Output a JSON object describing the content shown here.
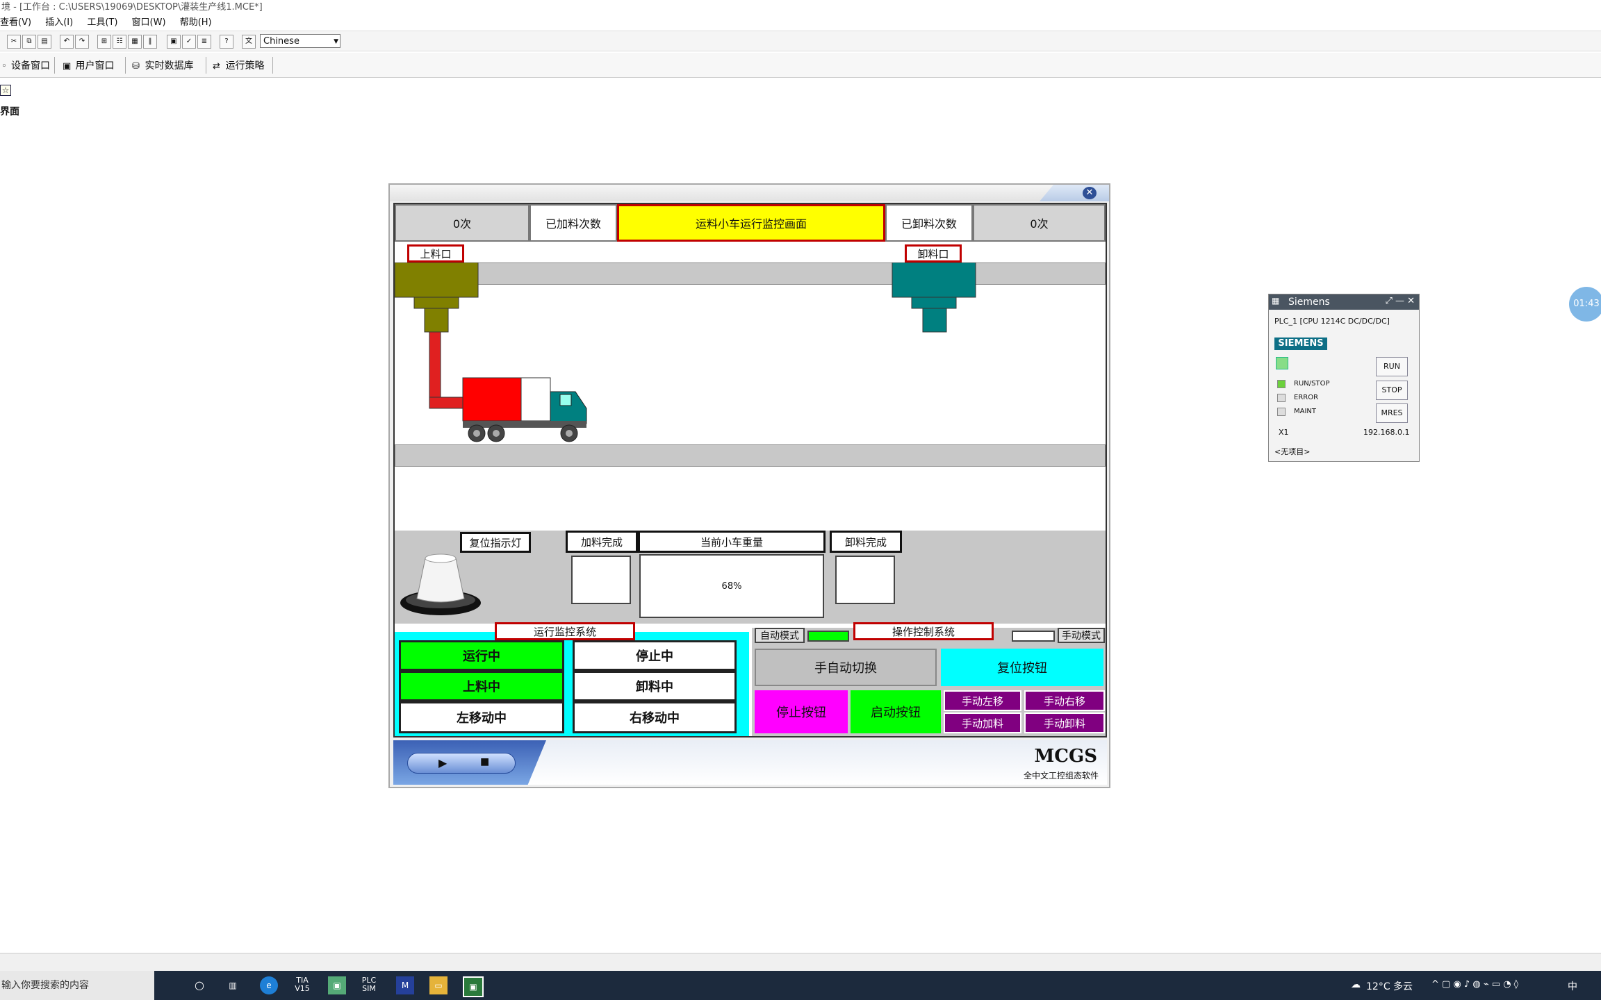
{
  "app": {
    "title": "境 - [工作台 : C:\\USERS\\19069\\DESKTOP\\灌装生产线1.MCE*]",
    "menu": [
      "查看(V)",
      "插入(I)",
      "工具(T)",
      "窗口(W)",
      "帮助(H)"
    ],
    "language_select": "Chinese",
    "nav_tabs": [
      "设备窗口",
      "用户窗口",
      "实时数据库",
      "运行策略"
    ],
    "desktop_item_label": "界面"
  },
  "mcgs": {
    "header": {
      "load_count_value": "0次",
      "load_count_label": "已加料次数",
      "screen_title": "运料小车运行监控画面",
      "unload_count_label": "已卸料次数",
      "unload_count_value": "0次"
    },
    "loading_port_label": "上料口",
    "unloading_port_label": "卸料口",
    "reset_lamp_label": "复位指示灯",
    "load_done_label": "加料完成",
    "current_weight_label": "当前小车重量",
    "current_weight_value": "68%",
    "unload_done_label": "卸料完成",
    "run_monitor_title": "运行监控系统",
    "operation_title": "操作控制系统",
    "status_indicators": [
      {
        "label": "运行中",
        "color": "#00ff00"
      },
      {
        "label": "停止中",
        "color": "#ffffff"
      },
      {
        "label": "上料中",
        "color": "#00ff00"
      },
      {
        "label": "卸料中",
        "color": "#ffffff"
      },
      {
        "label": "左移动中",
        "color": "#ffffff"
      },
      {
        "label": "右移动中",
        "color": "#ffffff"
      }
    ],
    "auto_mode_label": "自动模式",
    "manual_mode_label": "手动模式",
    "buttons": {
      "toggle": "手自动切换",
      "reset": "复位按钮",
      "stop": "停止按钮",
      "start": "启动按钮",
      "manual_left": "手动左移",
      "manual_right": "手动右移",
      "manual_load": "手动加料",
      "manual_unload": "手动卸料"
    },
    "logo": "MCGS",
    "logo_sub": "全中文工控组态软件",
    "colors": {
      "loading_hopper": "#808000",
      "unloading_hopper": "#008080",
      "truck_cargo": "#ff0000",
      "truck_cab": "#008080",
      "stop_button": "#ff00ff",
      "start_button": "#00ff00",
      "reset_button": "#00ffff",
      "manual_buttons": "#800080",
      "run_monitor_bg": "#00ffff"
    }
  },
  "plcsim": {
    "title": "Siemens",
    "device": "PLC_1 [CPU 1214C DC/DC/DC]",
    "brand": "SIEMENS",
    "leds": [
      "RUN/STOP",
      "ERROR",
      "MAINT"
    ],
    "buttons": [
      "RUN",
      "STOP",
      "MRES"
    ],
    "port": "X1",
    "ip": "192.168.0.1",
    "project": "<无项目>"
  },
  "timer": "01:43",
  "taskbar": {
    "search_placeholder": "输入你要搜索的内容",
    "apps": [
      "TIA V15",
      "PLC SIM"
    ],
    "weather": "12°C 多云",
    "ime": "中"
  }
}
